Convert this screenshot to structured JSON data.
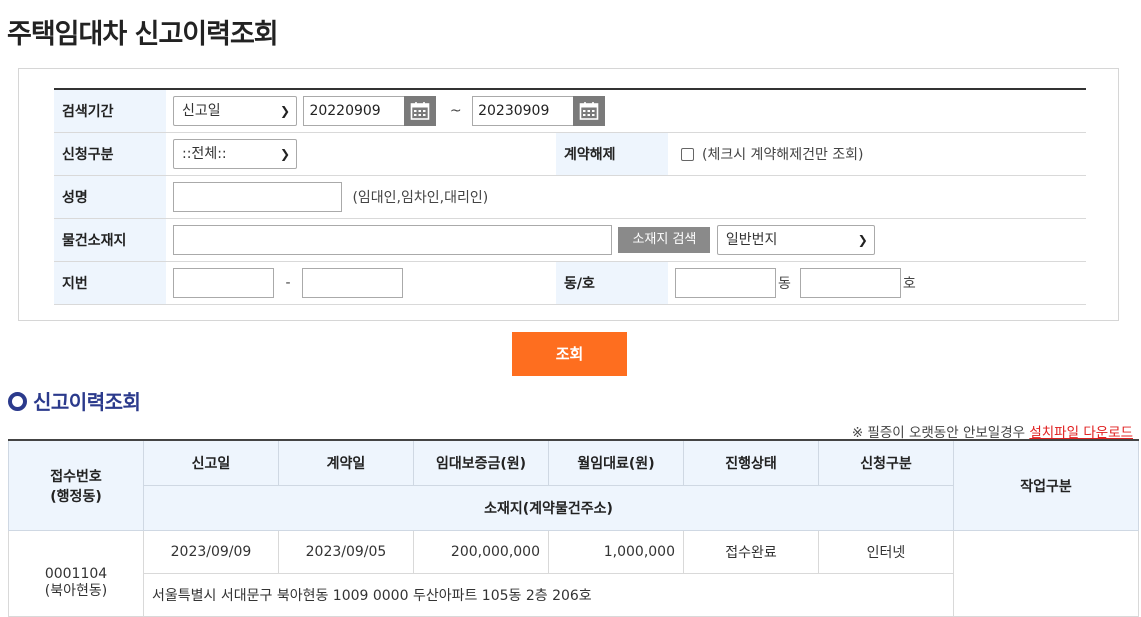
{
  "page": {
    "title": "주택임대차 신고이력조회"
  },
  "form": {
    "period": {
      "label": "검색기간",
      "type_value": "신고일",
      "start_date": "20220909",
      "tilde": "~",
      "end_date": "20230909"
    },
    "category": {
      "label": "신청구분",
      "value": "::전체::"
    },
    "cancel": {
      "label": "계약해제",
      "hint": "(체크시 계약해제건만 조회)"
    },
    "name": {
      "label": "성명",
      "hint": "(임대인,임차인,대리인)"
    },
    "location": {
      "label": "물건소재지",
      "search_button": "소재지 검색",
      "lot_type": "일반번지"
    },
    "lot": {
      "label": "지번",
      "dash": "-"
    },
    "unit": {
      "label": "동/호",
      "dong_suffix": "동",
      "ho_suffix": "호"
    }
  },
  "query_button": "조회",
  "section": {
    "title": "신고이력조회"
  },
  "notice": {
    "prefix": "※ 필증이 오랫동안 안보일경우 ",
    "link": "설치파일 다운로드"
  },
  "results": {
    "headers": {
      "receipt": "접수번호",
      "receipt_sub": "(행정동)",
      "report_date": "신고일",
      "contract_date": "계약일",
      "deposit": "임대보증금(원)",
      "monthly_rent": "월임대료(원)",
      "status": "진행상태",
      "category": "신청구분",
      "address": "소재지(계약물건주소)",
      "action": "작업구분"
    },
    "rows": [
      {
        "receipt_no": "0001104",
        "dong": "(북아현동)",
        "report_date": "2023/09/09",
        "contract_date": "2023/09/05",
        "deposit": "200,000,000",
        "monthly_rent": "1,000,000",
        "status": "접수완료",
        "category": "인터넷",
        "address": "서울특별시 서대문구 북아현동 1009 0000 두산아파트 105동 2층 206호"
      }
    ]
  }
}
